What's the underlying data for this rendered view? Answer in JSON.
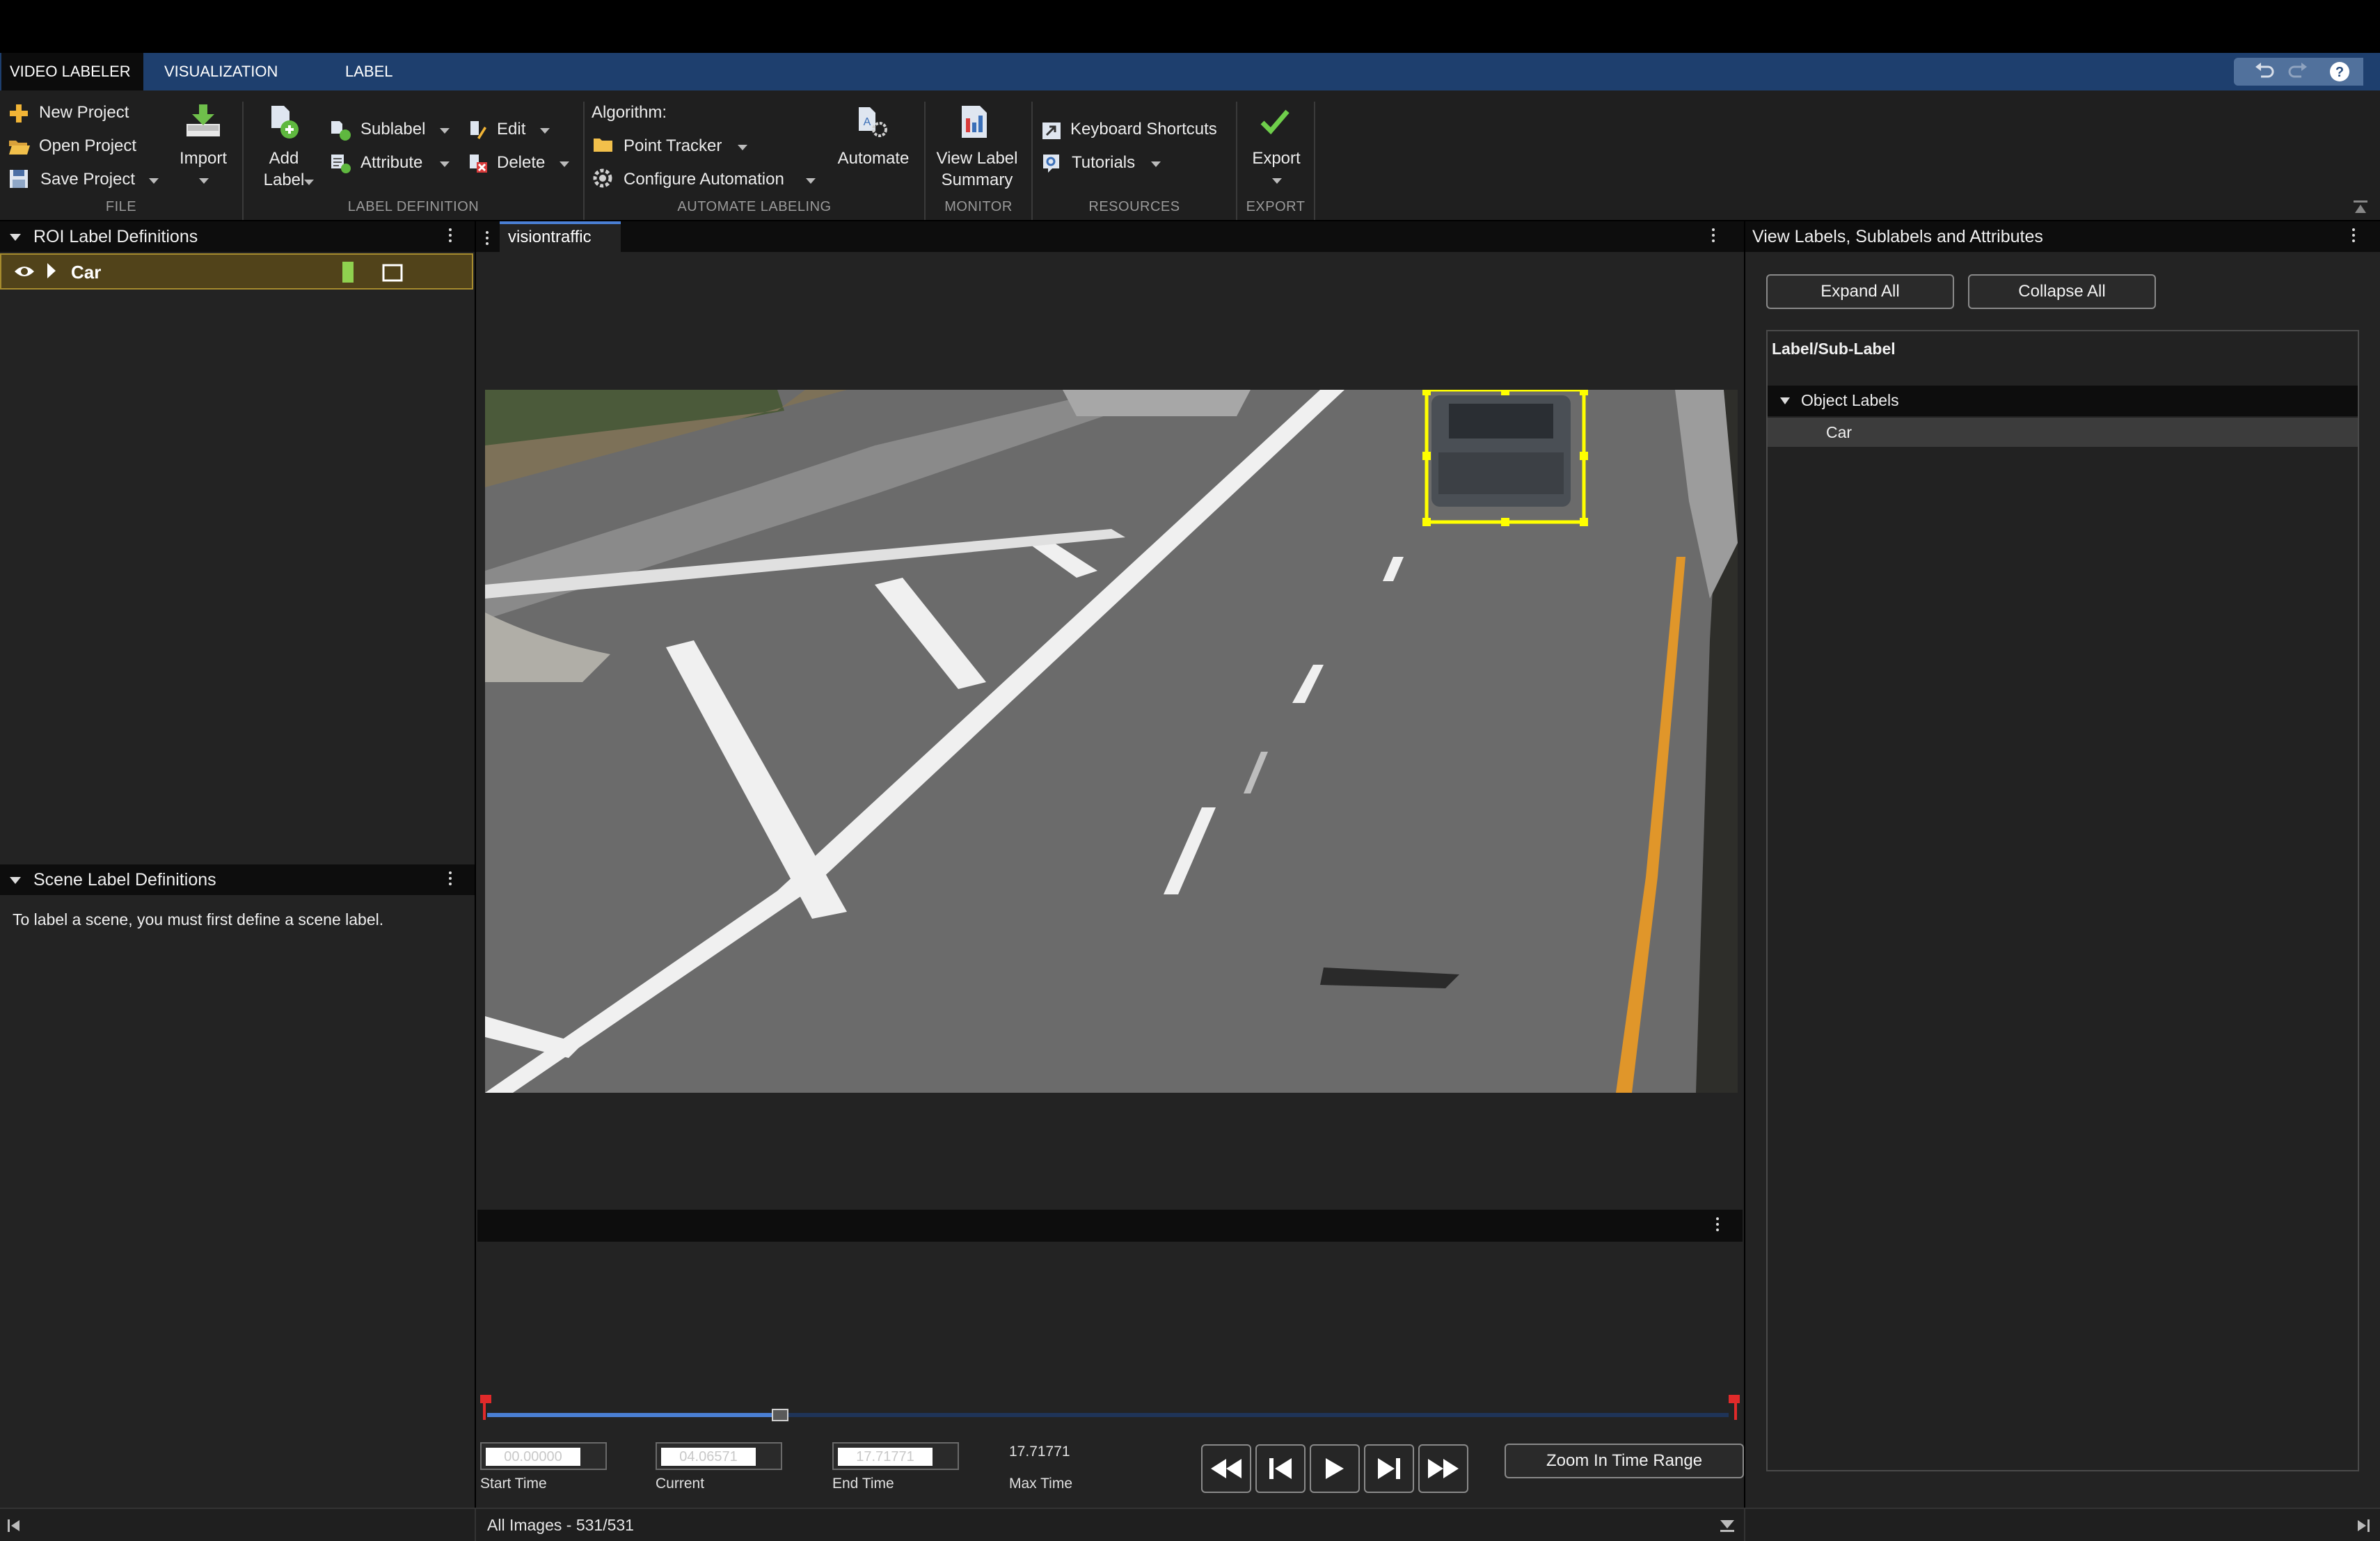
{
  "tabs": [
    "VIDEO LABELER",
    "VISUALIZATION",
    "LABEL"
  ],
  "ribbon": {
    "file": {
      "new_project": "New Project",
      "open_project": "Open Project",
      "save_project": "Save Project",
      "import": "Import",
      "section": "FILE"
    },
    "label_definition": {
      "add_label_l1": "Add",
      "add_label_l2": "Label",
      "sublabel": "Sublabel",
      "attribute": "Attribute",
      "edit": "Edit",
      "delete": "Delete",
      "section": "LABEL DEFINITION"
    },
    "automate_labeling": {
      "algorithm_label": "Algorithm:",
      "point_tracker": "Point Tracker",
      "configure_automation": "Configure Automation",
      "automate": "Automate",
      "section": "AUTOMATE LABELING"
    },
    "monitor": {
      "view_label_l1": "View Label",
      "view_label_l2": "Summary",
      "section": "MONITOR"
    },
    "resources": {
      "keyboard_shortcuts": "Keyboard Shortcuts",
      "tutorials": "Tutorials",
      "section": "RESOURCES"
    },
    "export": {
      "export": "Export",
      "section": "EXPORT"
    }
  },
  "roi_panel": {
    "title": "ROI Label Definitions",
    "labels": [
      {
        "name": "Car",
        "color": "#8fd14f"
      }
    ]
  },
  "scene_panel": {
    "title": "Scene Label Definitions",
    "message": "To label a scene, you must first define a scene label."
  },
  "video": {
    "tab_name": "visiontraffic",
    "bbox_color": "#ffff00"
  },
  "timeline": {
    "progress": 0.236,
    "start_time": "00.00000",
    "start_time_label": "Start Time",
    "current_time": "04.06571",
    "current_label": "Current",
    "end_time": "17.71771",
    "end_time_label": "End Time",
    "max_time": "17.71771",
    "max_time_label": "Max Time",
    "zoom_button": "Zoom In Time Range"
  },
  "right_panel": {
    "title": "View Labels, Sublabels and Attributes",
    "expand_all": "Expand All",
    "collapse_all": "Collapse All",
    "column_header": "Label/Sub-Label",
    "group": "Object Labels",
    "items": [
      "Car"
    ]
  },
  "status": {
    "text": "All Images - 531/531"
  },
  "colors": {
    "accent_tab": "#1e3f6e",
    "roi_row": "#51431a",
    "roi_border": "#a68b2e",
    "timeline_red": "#e02a2a",
    "timeline_blue": "#4a7fd4"
  }
}
